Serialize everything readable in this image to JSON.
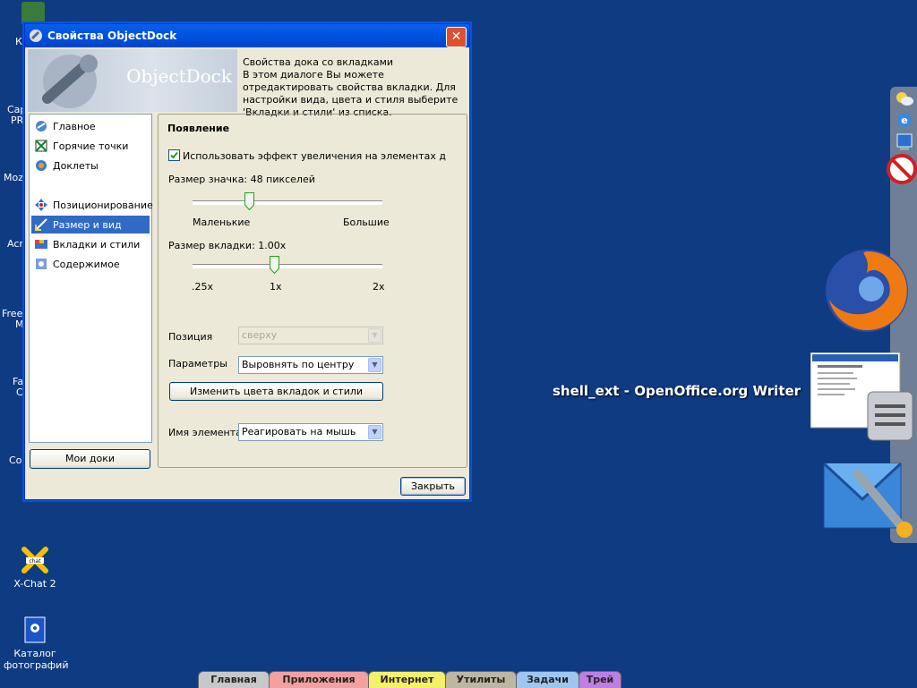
{
  "desktop": {
    "icons": [
      {
        "label": "X-Chat 2",
        "icon": "xchat-icon"
      },
      {
        "label": "Каталог фотографий",
        "icon": "photo-catalog-icon"
      }
    ],
    "partial_labels": [
      "К",
      "Cap",
      "PR",
      "Mozi",
      "Acr",
      "Free",
      "M",
      "Fa",
      "C",
      "Co"
    ]
  },
  "dialog": {
    "title": "Свойства ObjectDock",
    "banner_logo": "ObjectDock",
    "banner_heading": "Свойства дока со вкладками",
    "banner_text": "В этом диалоге Вы можете отредактировать свойства вкладки. Для настройки вида, цвета и стиля выберите 'Вкладки и стили' из списка.",
    "nav": [
      {
        "label": "Главное",
        "icon": "home-icon"
      },
      {
        "label": "Горячие точки",
        "icon": "hotspot-icon"
      },
      {
        "label": "Доклеты",
        "icon": "docklets-icon"
      },
      {
        "label": "Позиционирование",
        "icon": "positioning-icon"
      },
      {
        "label": "Размер и вид",
        "icon": "size-view-icon",
        "selected": true
      },
      {
        "label": "Вкладки и стили",
        "icon": "tabs-styles-icon"
      },
      {
        "label": "Содержимое",
        "icon": "contents-icon"
      }
    ],
    "my_docks_button": "Мои доки",
    "section_title": "Появление",
    "zoom_checkbox": {
      "label": "Использовать эффект увеличения на элементах д",
      "checked": true
    },
    "icon_size": {
      "label": "Размер значка: 48 пикселей",
      "min_label": "Маленькие",
      "max_label": "Большие",
      "value_fraction": 0.3
    },
    "tab_size": {
      "label": "Размер вкладки: 1.00x",
      "ticks": [
        ".25x",
        "1x",
        "2x"
      ],
      "value_fraction": 0.43
    },
    "position": {
      "label": "Позиция",
      "value": "сверху"
    },
    "parameters": {
      "label": "Параметры",
      "value": "Выровнять по центру"
    },
    "change_colors_button": "Изменить цвета вкладок и стили",
    "item_name": {
      "label": "Имя элемента:",
      "value": "Реагировать на мышь"
    },
    "close_button": "Закрыть"
  },
  "dock": {
    "hover_label": "shell_ext - OpenOffice.org Writer",
    "tabs": [
      {
        "label": "Главная",
        "color": "#c8c8c8"
      },
      {
        "label": "Приложения",
        "color": "#f2a0a0"
      },
      {
        "label": "Интернет",
        "color": "#f4f06a"
      },
      {
        "label": "Утилиты",
        "color": "#bdb6a0"
      },
      {
        "label": "Задачи",
        "color": "#9fc6ef"
      },
      {
        "label": "Трей",
        "color": "#c07ee0"
      }
    ]
  }
}
